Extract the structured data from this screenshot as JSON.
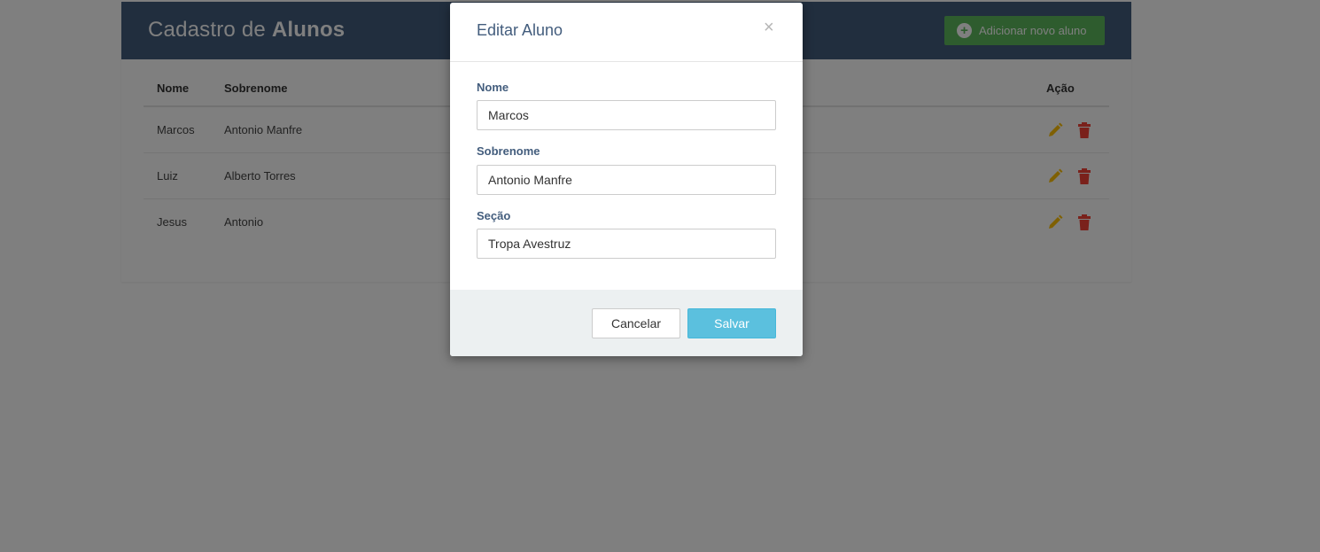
{
  "header": {
    "title_prefix": "Cadastro de ",
    "title_bold": "Alunos",
    "add_button_label": "Adicionar novo aluno",
    "add_icon": "plus-circle-icon"
  },
  "table": {
    "columns": [
      "Nome",
      "Sobrenome",
      "Ação"
    ],
    "rows": [
      {
        "nome": "Marcos",
        "sobrenome": "Antonio Manfre"
      },
      {
        "nome": "Luiz",
        "sobrenome": "Alberto Torres"
      },
      {
        "nome": "Jesus",
        "sobrenome": "Antonio"
      }
    ],
    "row_actions": [
      "edit-pencil-icon",
      "delete-trash-icon"
    ]
  },
  "modal": {
    "title": "Editar Aluno",
    "close_symbol": "×",
    "fields": [
      {
        "label": "Nome",
        "value": "Marcos"
      },
      {
        "label": "Sobrenome",
        "value": "Antonio Manfre"
      },
      {
        "label": "Seção",
        "value": "Tropa Avestruz"
      }
    ],
    "cancel_label": "Cancelar",
    "save_label": "Salvar"
  },
  "colors": {
    "header_bg": "#435d7d",
    "add_button": "#5cb85c",
    "edit_icon": "#ffc107",
    "delete_icon": "#f44336",
    "save_button": "#5bc0de",
    "modal_footer": "#ecf0f1"
  }
}
